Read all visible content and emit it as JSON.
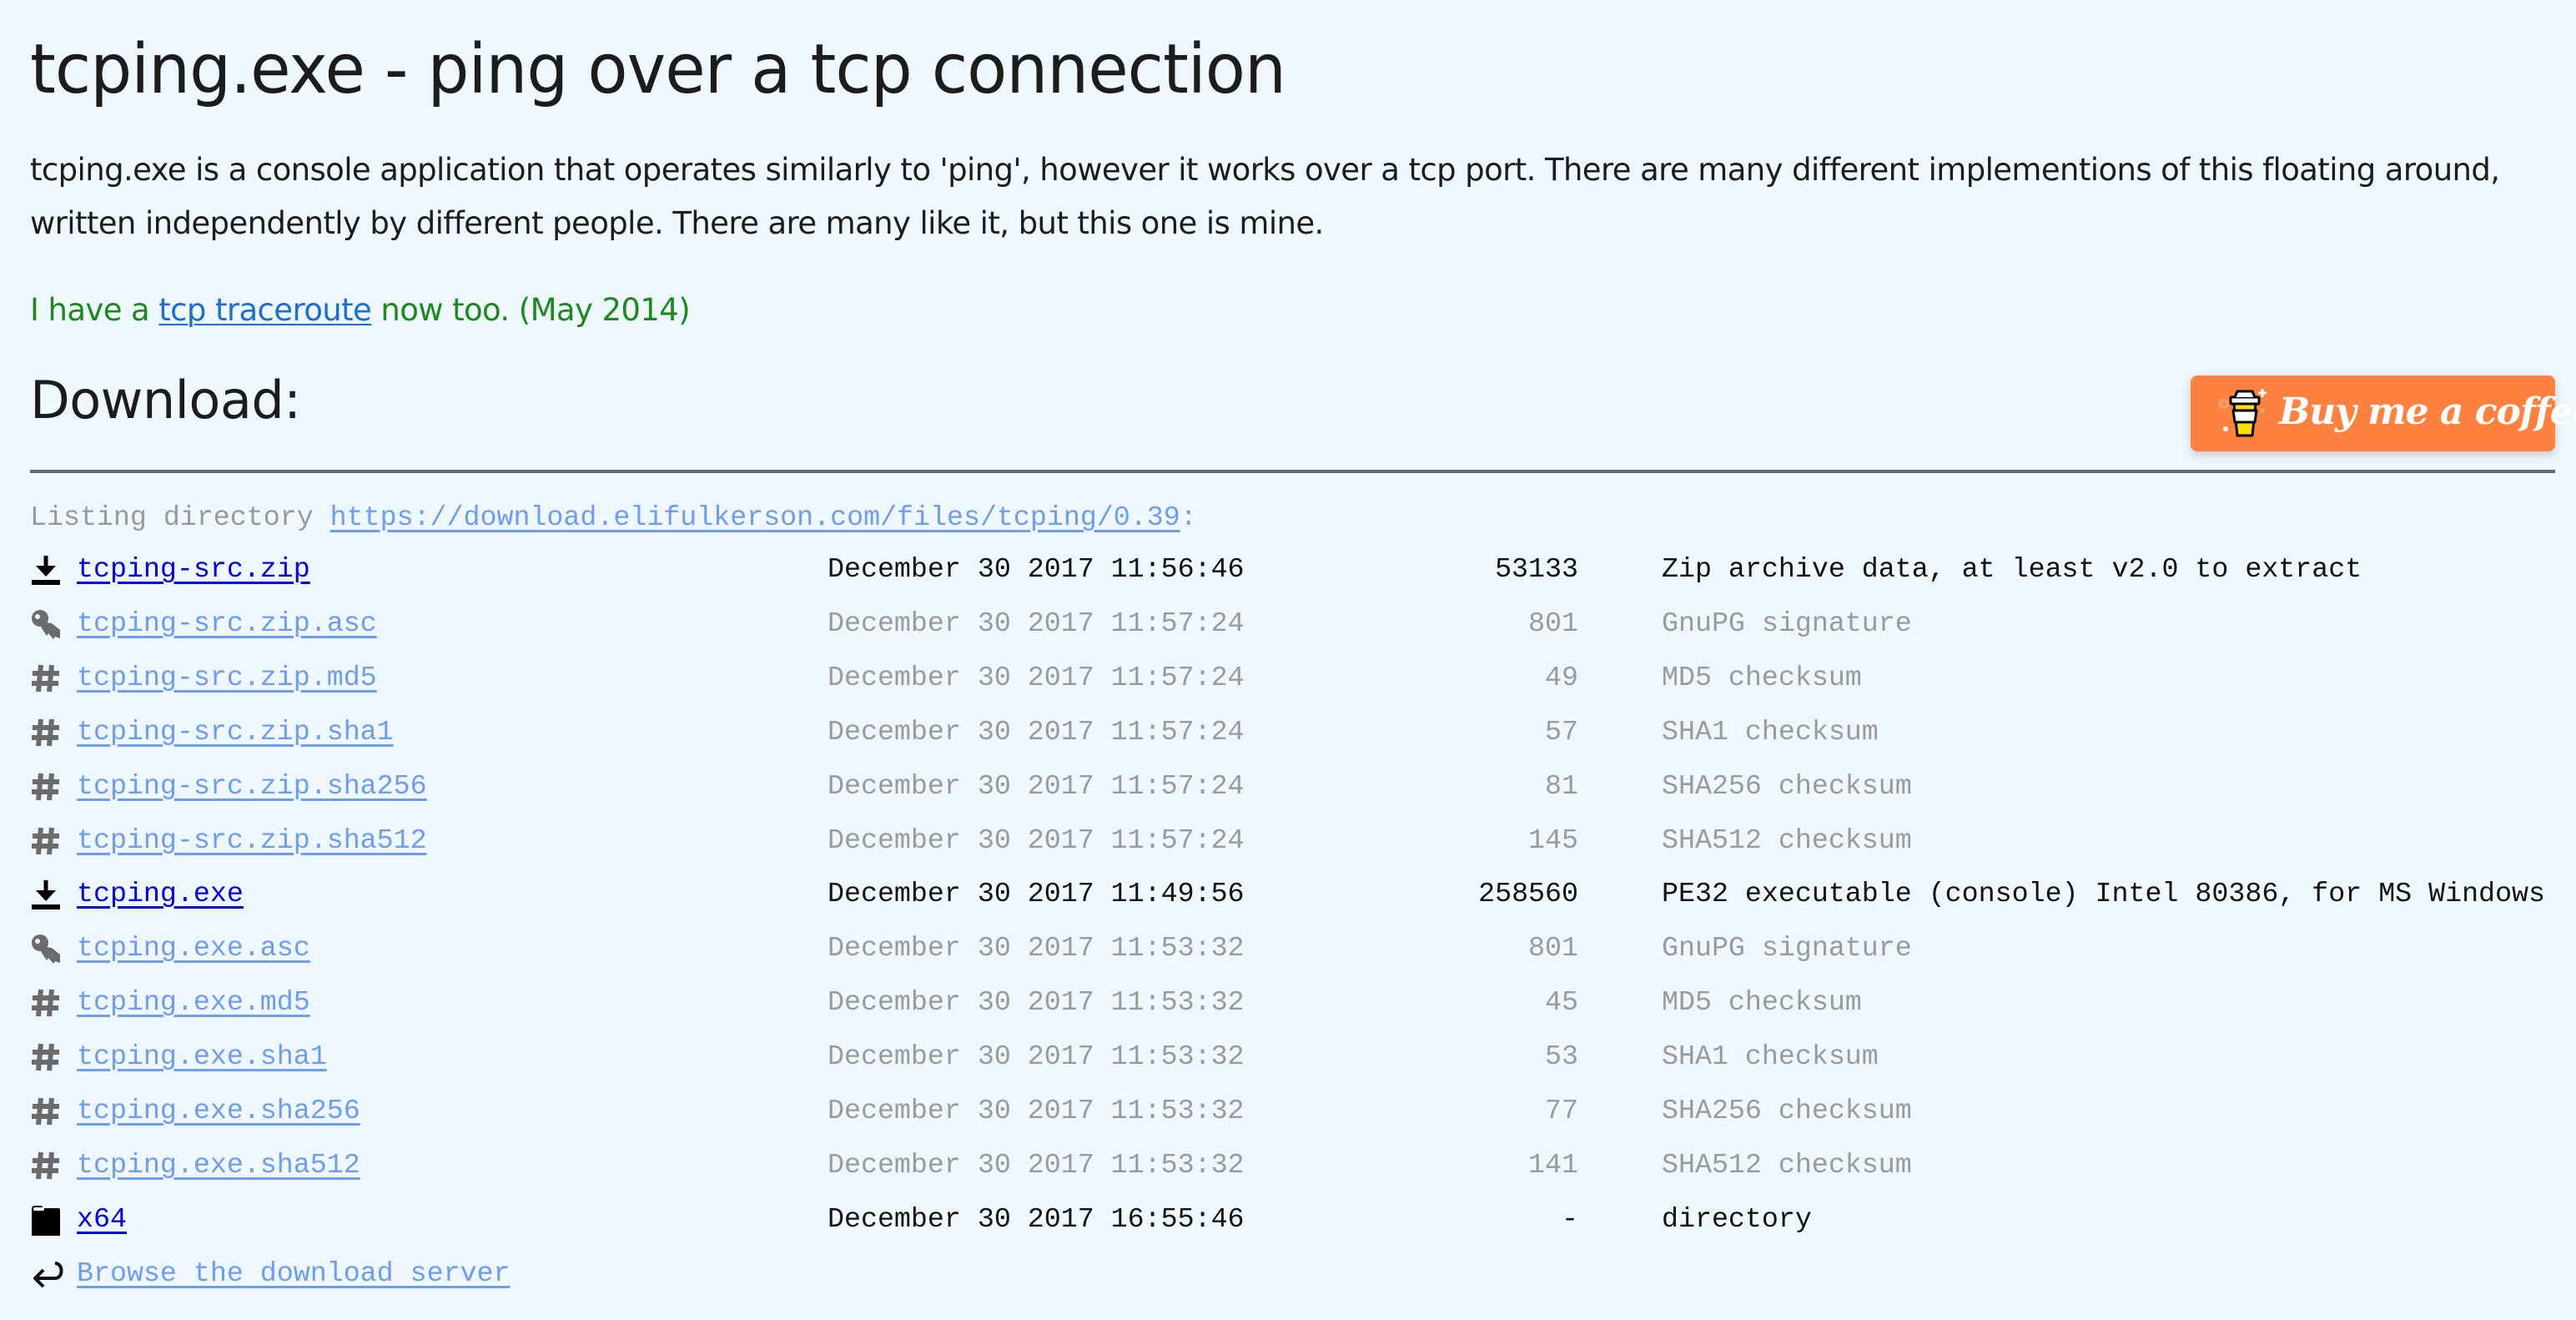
{
  "page": {
    "title": "tcping.exe - ping over a tcp connection",
    "intro": "tcping.exe is a console application that operates similarly to 'ping', however it works over a tcp port. There are many different implementions of this floating around, written independently by different people. There are many like it, but this one is mine.",
    "news": {
      "prefix": "I have a ",
      "link_label": "tcp traceroute",
      "suffix": " now too. (May 2014)"
    },
    "download_heading": "Download:",
    "coffee_button": {
      "label": "Buy me a coffee",
      "icon": "coffee-cup-icon"
    }
  },
  "colors": {
    "background": "#eff7fe",
    "news_green": "#1a8a1a",
    "traceroute_link": "#1a6fd6",
    "primary_link": "#0000ee",
    "faded_link": "#6e9cf2",
    "faded_text": "#9a9a9a",
    "coffee_orange": "#ff813f"
  },
  "listing": {
    "prefix": "Listing directory ",
    "url": "https://download.elifulkerson.com/files/tcping/0.39",
    "suffix": ":",
    "rows": [
      {
        "icon": "download-icon",
        "name": "tcping-src.zip",
        "date": "December 30 2017 11:56:46",
        "size": "53133",
        "desc": "Zip archive data, at least v2.0 to extract",
        "style": "primary"
      },
      {
        "icon": "key-icon",
        "name": "tcping-src.zip.asc",
        "date": "December 30 2017 11:57:24",
        "size": "801",
        "desc": "GnuPG signature",
        "style": "faded"
      },
      {
        "icon": "hash-icon",
        "name": "tcping-src.zip.md5",
        "date": "December 30 2017 11:57:24",
        "size": "49",
        "desc": "MD5 checksum",
        "style": "faded"
      },
      {
        "icon": "hash-icon",
        "name": "tcping-src.zip.sha1",
        "date": "December 30 2017 11:57:24",
        "size": "57",
        "desc": "SHA1 checksum",
        "style": "faded"
      },
      {
        "icon": "hash-icon",
        "name": "tcping-src.zip.sha256",
        "date": "December 30 2017 11:57:24",
        "size": "81",
        "desc": "SHA256 checksum",
        "style": "faded"
      },
      {
        "icon": "hash-icon",
        "name": "tcping-src.zip.sha512",
        "date": "December 30 2017 11:57:24",
        "size": "145",
        "desc": "SHA512 checksum",
        "style": "faded"
      },
      {
        "icon": "download-icon",
        "name": "tcping.exe",
        "date": "December 30 2017 11:49:56",
        "size": "258560",
        "desc": "PE32 executable (console) Intel 80386, for MS Windows",
        "style": "primary"
      },
      {
        "icon": "key-icon",
        "name": "tcping.exe.asc",
        "date": "December 30 2017 11:53:32",
        "size": "801",
        "desc": "GnuPG signature",
        "style": "faded"
      },
      {
        "icon": "hash-icon",
        "name": "tcping.exe.md5",
        "date": "December 30 2017 11:53:32",
        "size": "45",
        "desc": "MD5 checksum",
        "style": "faded"
      },
      {
        "icon": "hash-icon",
        "name": "tcping.exe.sha1",
        "date": "December 30 2017 11:53:32",
        "size": "53",
        "desc": "SHA1 checksum",
        "style": "faded"
      },
      {
        "icon": "hash-icon",
        "name": "tcping.exe.sha256",
        "date": "December 30 2017 11:53:32",
        "size": "77",
        "desc": "SHA256 checksum",
        "style": "faded"
      },
      {
        "icon": "hash-icon",
        "name": "tcping.exe.sha512",
        "date": "December 30 2017 11:53:32",
        "size": "141",
        "desc": "SHA512 checksum",
        "style": "faded"
      },
      {
        "icon": "folder-icon",
        "name": "x64",
        "date": "December 30 2017 16:55:46",
        "size": "-",
        "desc": "directory",
        "style": "primary"
      }
    ],
    "browse": {
      "icon": "return-arrow-icon",
      "label": "Browse the download server"
    }
  }
}
